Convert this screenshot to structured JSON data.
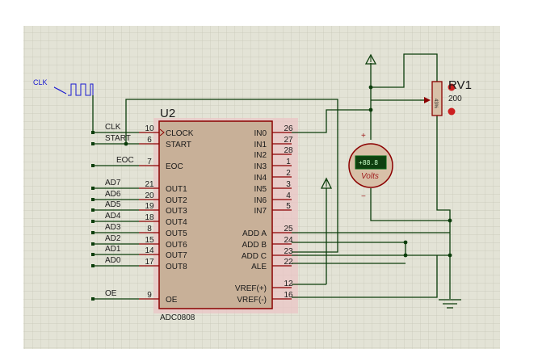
{
  "chip": {
    "ref": "U2",
    "part": "ADC0808",
    "left_pins": [
      {
        "name": "CLOCK",
        "num": "10"
      },
      {
        "name": "START",
        "num": "6"
      },
      {
        "name": "EOC",
        "num": "7"
      },
      {
        "name": "OUT1",
        "num": "21"
      },
      {
        "name": "OUT2",
        "num": "20"
      },
      {
        "name": "OUT3",
        "num": "19"
      },
      {
        "name": "OUT4",
        "num": "18"
      },
      {
        "name": "OUT5",
        "num": "8"
      },
      {
        "name": "OUT6",
        "num": "15"
      },
      {
        "name": "OUT7",
        "num": "14"
      },
      {
        "name": "OUT8",
        "num": "17"
      },
      {
        "name": "OE",
        "num": "9"
      }
    ],
    "right_pins": [
      {
        "name": "IN0",
        "num": "26"
      },
      {
        "name": "IN1",
        "num": "27"
      },
      {
        "name": "IN2",
        "num": "28"
      },
      {
        "name": "IN3",
        "num": "1"
      },
      {
        "name": "IN4",
        "num": "2"
      },
      {
        "name": "IN5",
        "num": "3"
      },
      {
        "name": "IN6",
        "num": "4"
      },
      {
        "name": "IN7",
        "num": "5"
      },
      {
        "name": "ADD A",
        "num": "25"
      },
      {
        "name": "ADD B",
        "num": "24"
      },
      {
        "name": "ADD C",
        "num": "23"
      },
      {
        "name": "ALE",
        "num": "22"
      },
      {
        "name": "VREF(+)",
        "num": "12"
      },
      {
        "name": "VREF(-)",
        "num": "16"
      }
    ]
  },
  "net_labels": [
    "CLK",
    "START",
    "EOC",
    "AD7",
    "AD6",
    "AD5",
    "AD4",
    "AD3",
    "AD2",
    "AD1",
    "AD0",
    "OE"
  ],
  "clock_source": {
    "label": "CLK"
  },
  "voltmeter": {
    "display": "+88.8",
    "unit": "Volts",
    "plus": "+",
    "minus": "−"
  },
  "potentiometer": {
    "ref": "RV1",
    "value": "200",
    "wiper": "43%"
  },
  "colors": {
    "grid_bg": "#e3e3d6",
    "grid_line": "#c6c6b6",
    "wire": "#0b3d0b",
    "chip_fill": "#c8b098",
    "chip_border": "#8b0000",
    "highlight": "#ebc6c6"
  }
}
